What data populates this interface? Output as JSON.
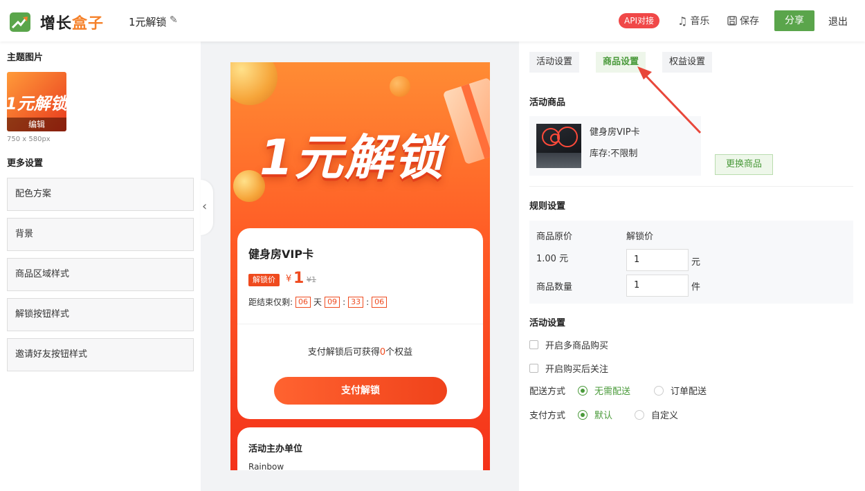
{
  "header": {
    "logo_part1": "增长",
    "logo_part2": "盒子",
    "doc_title": "1元解锁",
    "edit_icon": "pencil-icon",
    "api_badge": "API对接",
    "music_label": "音乐",
    "save_label": "保存",
    "share_label": "分享",
    "logout_label": "退出"
  },
  "left": {
    "theme_heading": "主题图片",
    "theme_image_text": "1元解锁",
    "theme_edit_label": "编辑",
    "theme_image_size": "750 x 580px",
    "more_heading": "更多设置",
    "items": [
      "配色方案",
      "背景",
      "商品区域样式",
      "解锁按钮样式",
      "邀请好友按钮样式"
    ]
  },
  "preview": {
    "banner_title": "1元解锁",
    "product_name": "健身房VIP卡",
    "unlock_tag": "解锁价",
    "currency": "¥",
    "price": "1",
    "original_price": "¥1",
    "countdown_label": "距结束仅剩:",
    "countdown": {
      "days": "06",
      "day_unit": "天",
      "hours": "09",
      "minutes": "33",
      "seconds": "06",
      "sep": ":"
    },
    "benefit_prefix": "支付解锁后可获得",
    "benefit_count": "0",
    "benefit_suffix": "个权益",
    "pay_button": "支付解锁",
    "organizer_heading": "活动主办单位",
    "organizer_value": "Rainbow"
  },
  "right": {
    "tabs": [
      {
        "label": "活动设置",
        "active": false
      },
      {
        "label": "商品设置",
        "active": true
      },
      {
        "label": "权益设置",
        "active": false
      }
    ],
    "goods_heading": "活动商品",
    "goods_name": "健身房VIP卡",
    "goods_stock": "库存:不限制",
    "change_goods_button": "更换商品",
    "rules_heading": "规则设置",
    "original_price_label": "商品原价",
    "original_price_value": "1.00 元",
    "unlock_price_label": "解锁价",
    "unlock_price_value": "1",
    "unlock_price_unit": "元",
    "quantity_label": "商品数量",
    "quantity_value": "1",
    "quantity_unit": "件",
    "activity_heading": "活动设置",
    "multi_goods_label": "开启多商品购买",
    "follow_label": "开启购买后关注",
    "delivery_label": "配送方式",
    "delivery_options": [
      {
        "label": "无需配送",
        "selected": true
      },
      {
        "label": "订单配送",
        "selected": false
      }
    ],
    "payment_label": "支付方式",
    "payment_options": [
      {
        "label": "默认",
        "selected": true
      },
      {
        "label": "自定义",
        "selected": false
      }
    ]
  },
  "colors": {
    "brand_green": "#5aa54b",
    "brand_orange": "#f5812a",
    "accent_red": "#ef4a1e",
    "api_red": "#f04848"
  }
}
